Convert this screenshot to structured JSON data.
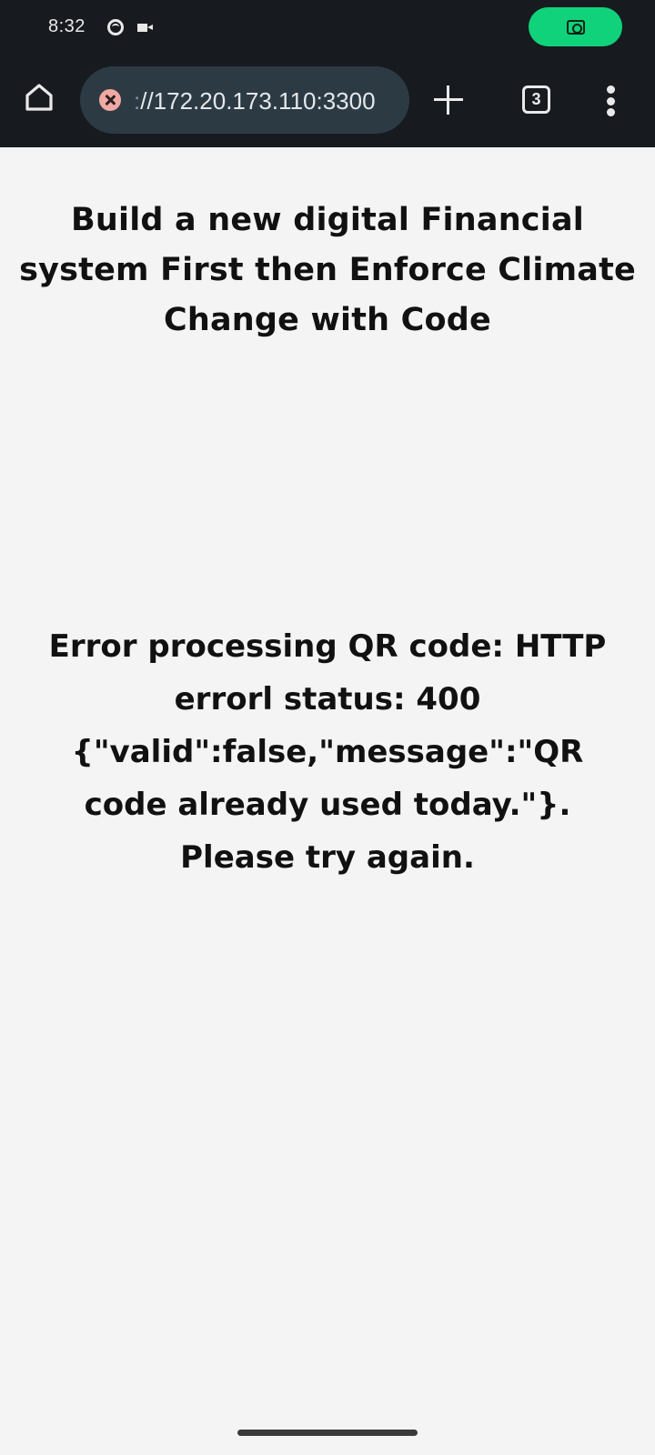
{
  "status_bar": {
    "time": "8:32",
    "indicator_icons": [
      "circle-icon",
      "video-record-icon"
    ],
    "screenshot_button_color": "#10d27a"
  },
  "browser": {
    "url_prefix": ":",
    "url": "//172.20.173.110:3300",
    "security_badge": "insecure-icon",
    "tab_count": "3",
    "icons": [
      "home-icon",
      "plus-icon",
      "tabs-icon",
      "more-icon"
    ]
  },
  "page": {
    "headline": "Build a new digital Financial system First then Enforce Climate Change with Code",
    "error_message": "Error processing QR code: HTTP errorl status: 400 {\"valid\":false,\"message\":\"QR code already used today.\"}. Please try again."
  }
}
